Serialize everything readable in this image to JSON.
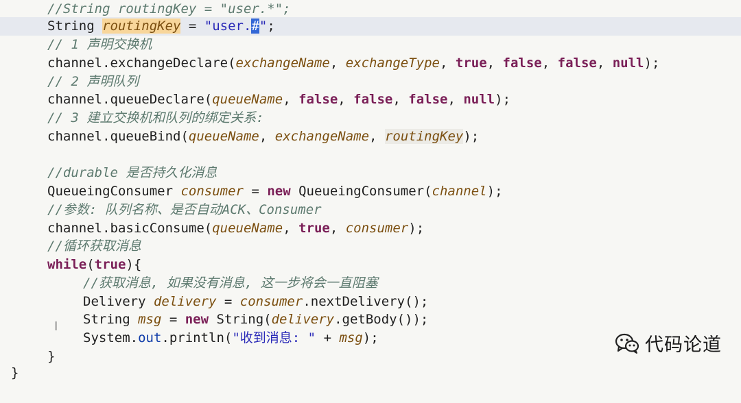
{
  "code_lines": [
    "//String routingKey = \"user.*\";",
    "String routingKey = \"user.#\";",
    "// 1 声明交换机",
    "channel.exchangeDeclare(exchangeName, exchangeType, true, false, false, null);",
    "// 2 声明队列",
    "channel.queueDeclare(queueName, false, false, false, null);",
    "// 3 建立交换机和队列的绑定关系:",
    "channel.queueBind(queueName, exchangeName, routingKey);",
    "",
    "//durable 是否持久化消息",
    "QueueingConsumer consumer = new QueueingConsumer(channel);",
    "//参数: 队列名称、是否自动ACK、Consumer",
    "channel.basicConsume(queueName, true, consumer);",
    "//循环获取消息",
    "while(true){",
    "    //获取消息, 如果没有消息, 这一步将会一直阻塞",
    "    Delivery delivery = consumer.nextDelivery();",
    "    String msg = new String(delivery.getBody());",
    "    System.out.println(\"收到消息: \" + msg);",
    "}"
  ],
  "tokens": {
    "t0_0": "//String routingKey = \"user.*\";",
    "t1_0": "String ",
    "t1_1": "routingKey",
    "t1_2": " = ",
    "t1_3": "\"user.",
    "t1_4": "#",
    "t1_5": "\"",
    "t1_6": ";",
    "t2_0": "// 1 声明交换机",
    "t3_0": "channel",
    "t3_1": ".exchangeDeclare(",
    "t3_2": "exchangeName",
    "t3_3": ", ",
    "t3_4": "exchangeType",
    "t3_5": ", ",
    "t3_6": "true",
    "t3_7": ", ",
    "t3_8": "false",
    "t3_9": ", ",
    "t3_10": "false",
    "t3_11": ", ",
    "t3_12": "null",
    "t3_13": ");",
    "t4_0": "// 2 声明队列",
    "t5_0": "channel",
    "t5_1": ".queueDeclare(",
    "t5_2": "queueName",
    "t5_3": ", ",
    "t5_4": "false",
    "t5_5": ", ",
    "t5_6": "false",
    "t5_7": ", ",
    "t5_8": "false",
    "t5_9": ", ",
    "t5_10": "null",
    "t5_11": ");",
    "t6_0": "// 3 建立交换机和队列的绑定关系:",
    "t7_0": "channel",
    "t7_1": ".queueBind(",
    "t7_2": "queueName",
    "t7_3": ", ",
    "t7_4": "exchangeName",
    "t7_5": ", ",
    "t7_6": "routingKey",
    "t7_7": ");",
    "t9_0": "//durable 是否持久化消息",
    "t10_0": "QueueingConsumer ",
    "t10_1": "consumer",
    "t10_2": " = ",
    "t10_3": "new",
    "t10_4": " QueueingConsumer(",
    "t10_5": "channel",
    "t10_6": ");",
    "t11_0": "//参数: 队列名称、是否自动ACK、Consumer",
    "t12_0": "channel",
    "t12_1": ".basicConsume(",
    "t12_2": "queueName",
    "t12_3": ", ",
    "t12_4": "true",
    "t12_5": ", ",
    "t12_6": "consumer",
    "t12_7": ");",
    "t13_0": "//循环获取消息",
    "t14_0": "while",
    "t14_1": "(",
    "t14_2": "true",
    "t14_3": "){",
    "t15_0": "//获取消息, 如果没有消息, 这一步将会一直阻塞",
    "t16_0": "Delivery ",
    "t16_1": "delivery",
    "t16_2": " = ",
    "t16_3": "consumer",
    "t16_4": ".nextDelivery();",
    "t17_0": "String ",
    "t17_1": "msg",
    "t17_2": " = ",
    "t17_3": "new",
    "t17_4": " String(",
    "t17_5": "delivery",
    "t17_6": ".getBody());",
    "t18_0": "System.",
    "t18_1": "out",
    "t18_2": ".println(",
    "t18_3": "\"收到消息: \"",
    "t18_4": " + ",
    "t18_5": "msg",
    "t18_6": ");",
    "t19_0": "}"
  },
  "closing_brace": "}",
  "cursor_glyph": "I",
  "watermark": {
    "text": "代码论道",
    "icon": "wechat-icon"
  },
  "colors": {
    "background": "#f7f7f4",
    "current_line": "#e6e9ef",
    "comment": "#5d7a6f",
    "keyword": "#7a1f57",
    "string": "#2a2ab8",
    "selection": "#3367d6",
    "highlight_variable": "#f8d69a"
  }
}
